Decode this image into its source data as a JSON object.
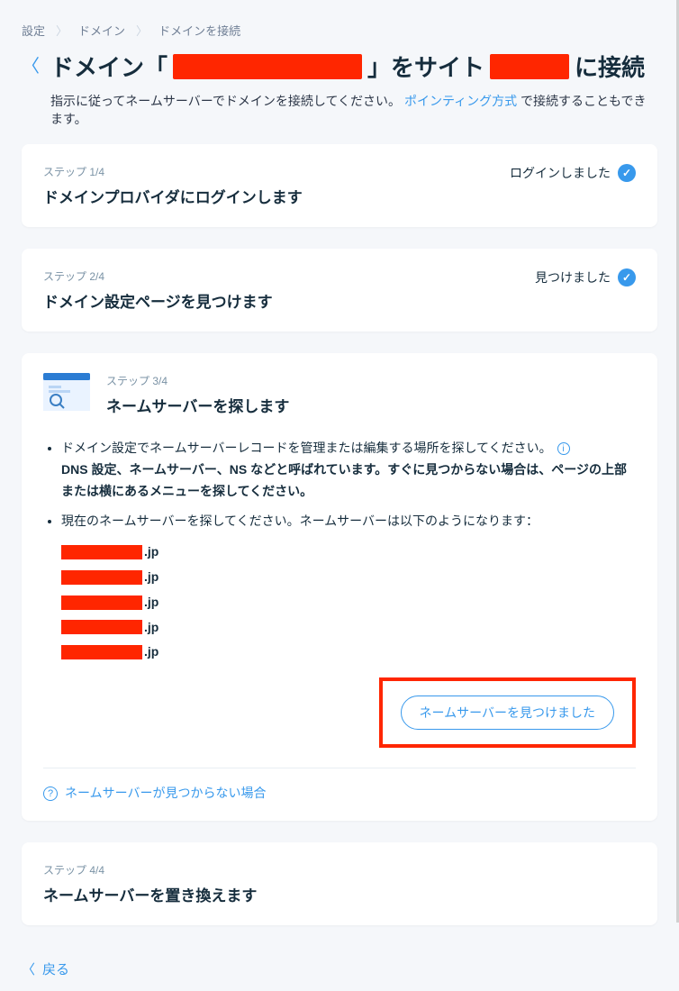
{
  "breadcrumb": {
    "item1": "設定",
    "item2": "ドメイン",
    "item3": "ドメインを接続"
  },
  "title": {
    "part1": "ドメイン「",
    "part2": "」をサイト",
    "part3": "に接続"
  },
  "subtitle": {
    "prefix": "指示に従ってネームサーバーでドメインを接続してください。",
    "link": "ポインティング方式",
    "suffix": "で接続することもできます。"
  },
  "step1": {
    "label": "ステップ 1/4",
    "title": "ドメインプロバイダにログインします",
    "status": "ログインしました"
  },
  "step2": {
    "label": "ステップ 2/4",
    "title": "ドメイン設定ページを見つけます",
    "status": "見つけました"
  },
  "step3": {
    "label": "ステップ 3/4",
    "title": "ネームサーバーを探します",
    "bullet1a": "ドメイン設定でネームサーバーレコードを管理または編集する場所を探してください。",
    "bullet1b": "DNS 設定、ネームサーバー、NS などと呼ばれています。すぐに見つからない場合は、ページの上部または横にあるメニューを探してください。",
    "bullet2": "現在のネームサーバーを探してください。ネームサーバーは以下のようになります：",
    "ns_suffix": ".jp",
    "button": "ネームサーバーを見つけました",
    "help": "ネームサーバーが見つからない場合"
  },
  "step4": {
    "label": "ステップ 4/4",
    "title": "ネームサーバーを置き換えます"
  },
  "footer": {
    "back": "戻る"
  }
}
